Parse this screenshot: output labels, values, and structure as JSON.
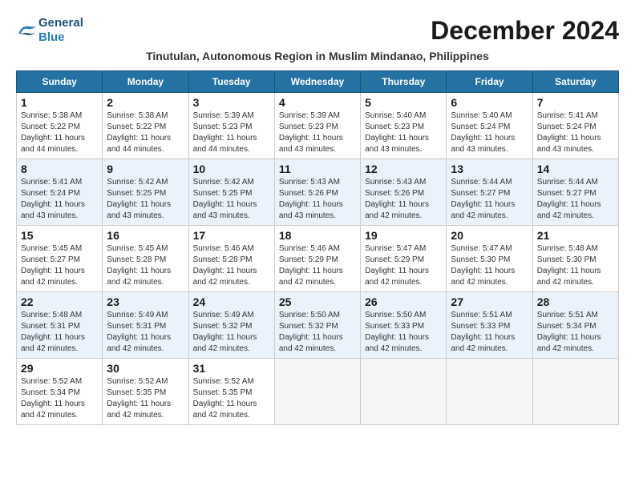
{
  "header": {
    "logo_general": "General",
    "logo_blue": "Blue",
    "month_title": "December 2024",
    "subtitle": "Tinutulan, Autonomous Region in Muslim Mindanao, Philippines"
  },
  "calendar": {
    "weekdays": [
      "Sunday",
      "Monday",
      "Tuesday",
      "Wednesday",
      "Thursday",
      "Friday",
      "Saturday"
    ],
    "weeks": [
      [
        {
          "day": "1",
          "sunrise": "Sunrise: 5:38 AM",
          "sunset": "Sunset: 5:22 PM",
          "daylight": "Daylight: 11 hours and 44 minutes."
        },
        {
          "day": "2",
          "sunrise": "Sunrise: 5:38 AM",
          "sunset": "Sunset: 5:22 PM",
          "daylight": "Daylight: 11 hours and 44 minutes."
        },
        {
          "day": "3",
          "sunrise": "Sunrise: 5:39 AM",
          "sunset": "Sunset: 5:23 PM",
          "daylight": "Daylight: 11 hours and 44 minutes."
        },
        {
          "day": "4",
          "sunrise": "Sunrise: 5:39 AM",
          "sunset": "Sunset: 5:23 PM",
          "daylight": "Daylight: 11 hours and 43 minutes."
        },
        {
          "day": "5",
          "sunrise": "Sunrise: 5:40 AM",
          "sunset": "Sunset: 5:23 PM",
          "daylight": "Daylight: 11 hours and 43 minutes."
        },
        {
          "day": "6",
          "sunrise": "Sunrise: 5:40 AM",
          "sunset": "Sunset: 5:24 PM",
          "daylight": "Daylight: 11 hours and 43 minutes."
        },
        {
          "day": "7",
          "sunrise": "Sunrise: 5:41 AM",
          "sunset": "Sunset: 5:24 PM",
          "daylight": "Daylight: 11 hours and 43 minutes."
        }
      ],
      [
        {
          "day": "8",
          "sunrise": "Sunrise: 5:41 AM",
          "sunset": "Sunset: 5:24 PM",
          "daylight": "Daylight: 11 hours and 43 minutes."
        },
        {
          "day": "9",
          "sunrise": "Sunrise: 5:42 AM",
          "sunset": "Sunset: 5:25 PM",
          "daylight": "Daylight: 11 hours and 43 minutes."
        },
        {
          "day": "10",
          "sunrise": "Sunrise: 5:42 AM",
          "sunset": "Sunset: 5:25 PM",
          "daylight": "Daylight: 11 hours and 43 minutes."
        },
        {
          "day": "11",
          "sunrise": "Sunrise: 5:43 AM",
          "sunset": "Sunset: 5:26 PM",
          "daylight": "Daylight: 11 hours and 43 minutes."
        },
        {
          "day": "12",
          "sunrise": "Sunrise: 5:43 AM",
          "sunset": "Sunset: 5:26 PM",
          "daylight": "Daylight: 11 hours and 42 minutes."
        },
        {
          "day": "13",
          "sunrise": "Sunrise: 5:44 AM",
          "sunset": "Sunset: 5:27 PM",
          "daylight": "Daylight: 11 hours and 42 minutes."
        },
        {
          "day": "14",
          "sunrise": "Sunrise: 5:44 AM",
          "sunset": "Sunset: 5:27 PM",
          "daylight": "Daylight: 11 hours and 42 minutes."
        }
      ],
      [
        {
          "day": "15",
          "sunrise": "Sunrise: 5:45 AM",
          "sunset": "Sunset: 5:27 PM",
          "daylight": "Daylight: 11 hours and 42 minutes."
        },
        {
          "day": "16",
          "sunrise": "Sunrise: 5:45 AM",
          "sunset": "Sunset: 5:28 PM",
          "daylight": "Daylight: 11 hours and 42 minutes."
        },
        {
          "day": "17",
          "sunrise": "Sunrise: 5:46 AM",
          "sunset": "Sunset: 5:28 PM",
          "daylight": "Daylight: 11 hours and 42 minutes."
        },
        {
          "day": "18",
          "sunrise": "Sunrise: 5:46 AM",
          "sunset": "Sunset: 5:29 PM",
          "daylight": "Daylight: 11 hours and 42 minutes."
        },
        {
          "day": "19",
          "sunrise": "Sunrise: 5:47 AM",
          "sunset": "Sunset: 5:29 PM",
          "daylight": "Daylight: 11 hours and 42 minutes."
        },
        {
          "day": "20",
          "sunrise": "Sunrise: 5:47 AM",
          "sunset": "Sunset: 5:30 PM",
          "daylight": "Daylight: 11 hours and 42 minutes."
        },
        {
          "day": "21",
          "sunrise": "Sunrise: 5:48 AM",
          "sunset": "Sunset: 5:30 PM",
          "daylight": "Daylight: 11 hours and 42 minutes."
        }
      ],
      [
        {
          "day": "22",
          "sunrise": "Sunrise: 5:48 AM",
          "sunset": "Sunset: 5:31 PM",
          "daylight": "Daylight: 11 hours and 42 minutes."
        },
        {
          "day": "23",
          "sunrise": "Sunrise: 5:49 AM",
          "sunset": "Sunset: 5:31 PM",
          "daylight": "Daylight: 11 hours and 42 minutes."
        },
        {
          "day": "24",
          "sunrise": "Sunrise: 5:49 AM",
          "sunset": "Sunset: 5:32 PM",
          "daylight": "Daylight: 11 hours and 42 minutes."
        },
        {
          "day": "25",
          "sunrise": "Sunrise: 5:50 AM",
          "sunset": "Sunset: 5:32 PM",
          "daylight": "Daylight: 11 hours and 42 minutes."
        },
        {
          "day": "26",
          "sunrise": "Sunrise: 5:50 AM",
          "sunset": "Sunset: 5:33 PM",
          "daylight": "Daylight: 11 hours and 42 minutes."
        },
        {
          "day": "27",
          "sunrise": "Sunrise: 5:51 AM",
          "sunset": "Sunset: 5:33 PM",
          "daylight": "Daylight: 11 hours and 42 minutes."
        },
        {
          "day": "28",
          "sunrise": "Sunrise: 5:51 AM",
          "sunset": "Sunset: 5:34 PM",
          "daylight": "Daylight: 11 hours and 42 minutes."
        }
      ],
      [
        {
          "day": "29",
          "sunrise": "Sunrise: 5:52 AM",
          "sunset": "Sunset: 5:34 PM",
          "daylight": "Daylight: 11 hours and 42 minutes."
        },
        {
          "day": "30",
          "sunrise": "Sunrise: 5:52 AM",
          "sunset": "Sunset: 5:35 PM",
          "daylight": "Daylight: 11 hours and 42 minutes."
        },
        {
          "day": "31",
          "sunrise": "Sunrise: 5:52 AM",
          "sunset": "Sunset: 5:35 PM",
          "daylight": "Daylight: 11 hours and 42 minutes."
        },
        null,
        null,
        null,
        null
      ]
    ]
  }
}
